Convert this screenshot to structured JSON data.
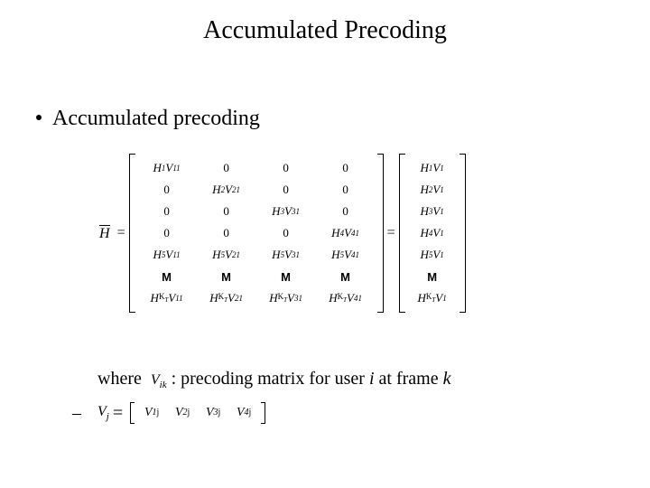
{
  "title": "Accumulated Precoding",
  "bullet": "Accumulated precoding",
  "lhs_symbol": "H",
  "eq": "=",
  "matrix": {
    "rows": [
      [
        "H_1V_11",
        "0",
        "0",
        "0"
      ],
      [
        "0",
        "H_2V_21",
        "0",
        "0"
      ],
      [
        "0",
        "0",
        "H_3V_31",
        "0"
      ],
      [
        "0",
        "0",
        "0",
        "H_4V_41"
      ],
      [
        "H_5V_11",
        "H_5V_21",
        "H_5V_31",
        "H_5V_41"
      ],
      [
        "vdots",
        "vdots",
        "vdots",
        "vdots"
      ],
      [
        "H_KT V_11",
        "H_KT V_21",
        "H_KT V_31",
        "H_KT V_41"
      ]
    ]
  },
  "vector": [
    "H_1V_1",
    "H_2V_1",
    "H_3V_1",
    "H_4V_1",
    "H_5V_1",
    "vdots",
    "H_KT V_1"
  ],
  "where": {
    "label": "where",
    "symbol": "V",
    "sub": "ik",
    "desc_pre": " : precoding matrix for user ",
    "i": "i",
    "desc_mid": " at frame ",
    "k": "k"
  },
  "vj": {
    "lhs": "V",
    "lhs_sub": "j",
    "eq": "=",
    "items": [
      "V_1j",
      "V_2j",
      "V_3j",
      "V_4j"
    ]
  },
  "vdots_glyph": "M"
}
